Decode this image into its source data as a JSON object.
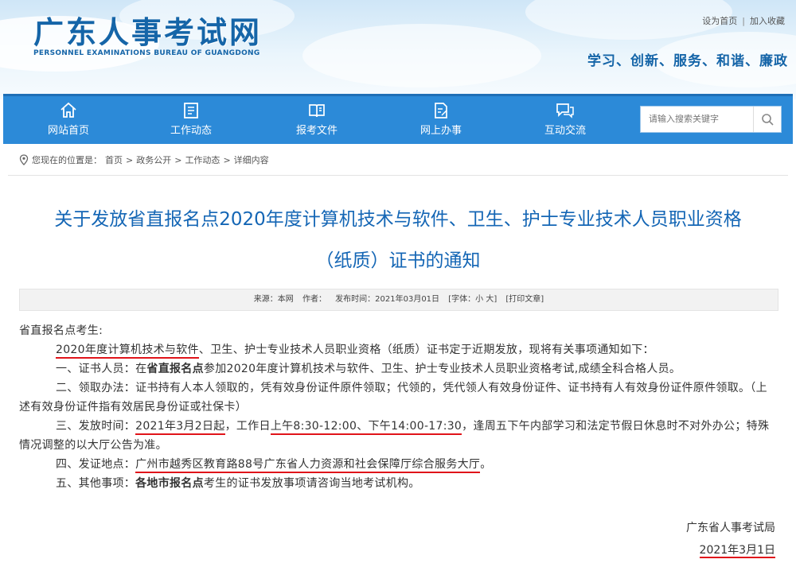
{
  "header": {
    "logo_cn": "广东人事考试网",
    "logo_en": "PERSONNEL EXAMINATIONS BUREAU OF GUANGDONG",
    "top_links": [
      "设为首页",
      "加入收藏"
    ],
    "slogan": "学习、创新、服务、和谐、廉政"
  },
  "nav": {
    "items": [
      {
        "label": "网站首页",
        "icon": "home-icon"
      },
      {
        "label": "工作动态",
        "icon": "news-list-icon"
      },
      {
        "label": "报考文件",
        "icon": "book-icon"
      },
      {
        "label": "网上办事",
        "icon": "edit-document-icon"
      },
      {
        "label": "互动交流",
        "icon": "chat-icon"
      }
    ],
    "search_placeholder": "请输入搜索关键字",
    "search_icon": "search-icon"
  },
  "breadcrumb": {
    "prefix": "您现在的位置是：",
    "items": [
      "首页",
      "政务公开",
      "工作动态",
      "详细内容"
    ],
    "separator": ">"
  },
  "article": {
    "title_line1": "关于发放省直报名点2020年度计算机技术与软件、卫生、护士专业技术人员职业资格",
    "title_line2": "（纸质）证书的通知",
    "meta": {
      "source": "来源：本网",
      "author": "作者：",
      "time": "发布时间：2021年03月01日",
      "font": "[字体：小 大]",
      "print": "[打印文章]"
    },
    "greeting": "省直报名点考生:",
    "intro_ul": "2020年度计算机技术与软件",
    "intro_rest": "、卫生、护士专业技术人员职业资格（纸质）证书定于近期发放，现将有关事项通知如下：",
    "item1_a": "一、证书人员：在",
    "item1_b": "省直报名点",
    "item1_c": "参加2020年度计算机技术与软件、卫生、护士专业技术人员职业资格考试,成绩全科合格人员。",
    "item2": "二、领取办法：证书持有人本人领取的，凭有效身份证件原件领取；代领的，凭代领人有效身份证件、证书持有人有效身份证件原件领取。（上述有效身份证件指有效居民身份证或社保卡）",
    "item3_a": "三、发放时间：",
    "item3_date": "2021年3月2日起",
    "item3_b": "，工作日",
    "item3_time": "上午8:30-12:00、下午14:00-17:30",
    "item3_c": "，逢周五下午内部学习和法定节假日休息时不对外办公；特殊情况调整的以大厅公告为准。",
    "item4_a": "四、发证地点：",
    "item4_place": "广州市越秀区教育路88号广东省人力资源和社会保障厅综合服务大厅",
    "item4_b": "。",
    "item5_a": "五、其他事项：",
    "item5_b": "各地市报名点",
    "item5_c": "考生的证书发放事项请咨询当地考试机构。",
    "signer": "广东省人事考试局",
    "date": "2021年3月1日"
  },
  "colors": {
    "brand_blue": "#1466b5",
    "nav_blue": "#2c8ad8",
    "underline_red": "#e0141a"
  }
}
